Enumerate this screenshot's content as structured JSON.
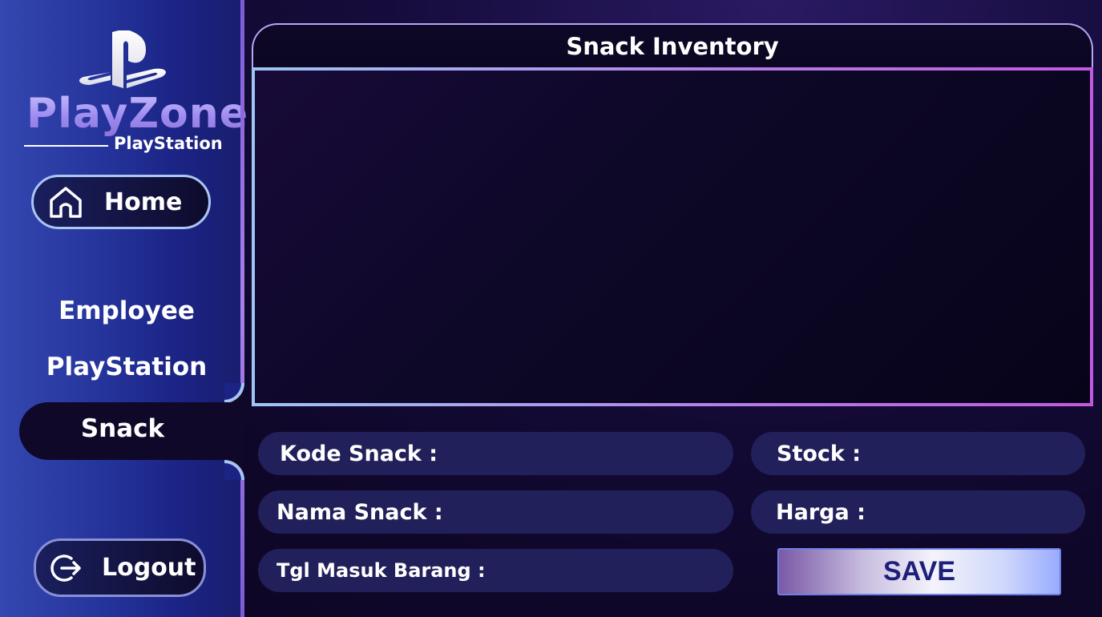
{
  "brand": {
    "name": "PlayZone",
    "subtitle": "PlayStation",
    "logo_icon": "playstation-logo-icon"
  },
  "sidebar": {
    "home": {
      "label": "Home",
      "icon": "home-icon"
    },
    "items": [
      {
        "label": "Employee"
      },
      {
        "label": "PlayStation"
      },
      {
        "label": "Snack",
        "active": true
      }
    ],
    "logout": {
      "label": "Logout",
      "icon": "logout-icon"
    }
  },
  "main": {
    "title": "Snack Inventory",
    "fields": {
      "kode_snack": {
        "label": "Kode Snack :"
      },
      "nama_snack": {
        "label": "Nama Snack :"
      },
      "tgl_masuk": {
        "label": "Tgl Masuk Barang :"
      },
      "stock": {
        "label": "Stock :"
      },
      "harga": {
        "label": "Harga :"
      }
    },
    "save_label": "SAVE"
  },
  "colors": {
    "sidebar_start": "#3447b0",
    "sidebar_end": "#1a1e6f",
    "field_bg": "#21205a",
    "save_text": "#1d1f7a",
    "accent_border": "#b57ae8"
  }
}
